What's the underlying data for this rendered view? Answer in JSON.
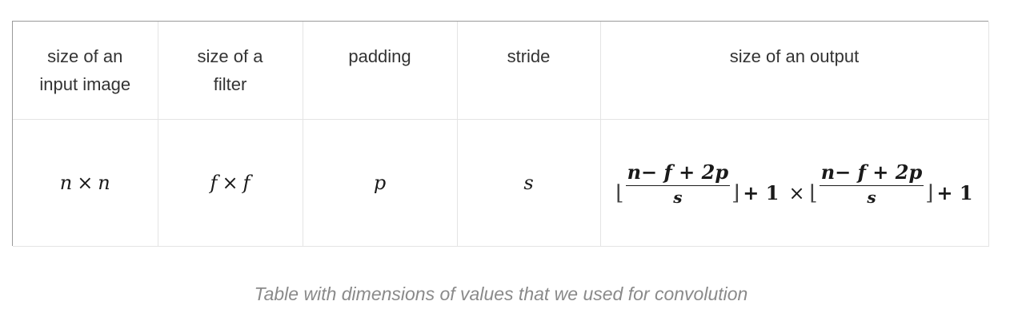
{
  "table": {
    "headers": [
      "size of an input image",
      "size of a filter",
      "padding",
      "stride",
      "size of an output"
    ],
    "header_lines": [
      [
        "size of an",
        "input image"
      ],
      [
        "size of a",
        "filter"
      ],
      [
        "padding"
      ],
      [
        "stride"
      ],
      [
        "size of an output"
      ]
    ],
    "row": {
      "input_size": {
        "left": "n",
        "op": "×",
        "right": "n"
      },
      "filter_size": {
        "left": "f",
        "op": "×",
        "right": "f"
      },
      "padding": "p",
      "stride": "s",
      "output": {
        "floor_open": "⌊",
        "numerator": "n− f + 2p",
        "denominator": "s",
        "floor_close": "⌋",
        "plus_one": "+ 1",
        "times": "×"
      }
    }
  },
  "caption": "Table with dimensions of values that we used for convolution"
}
